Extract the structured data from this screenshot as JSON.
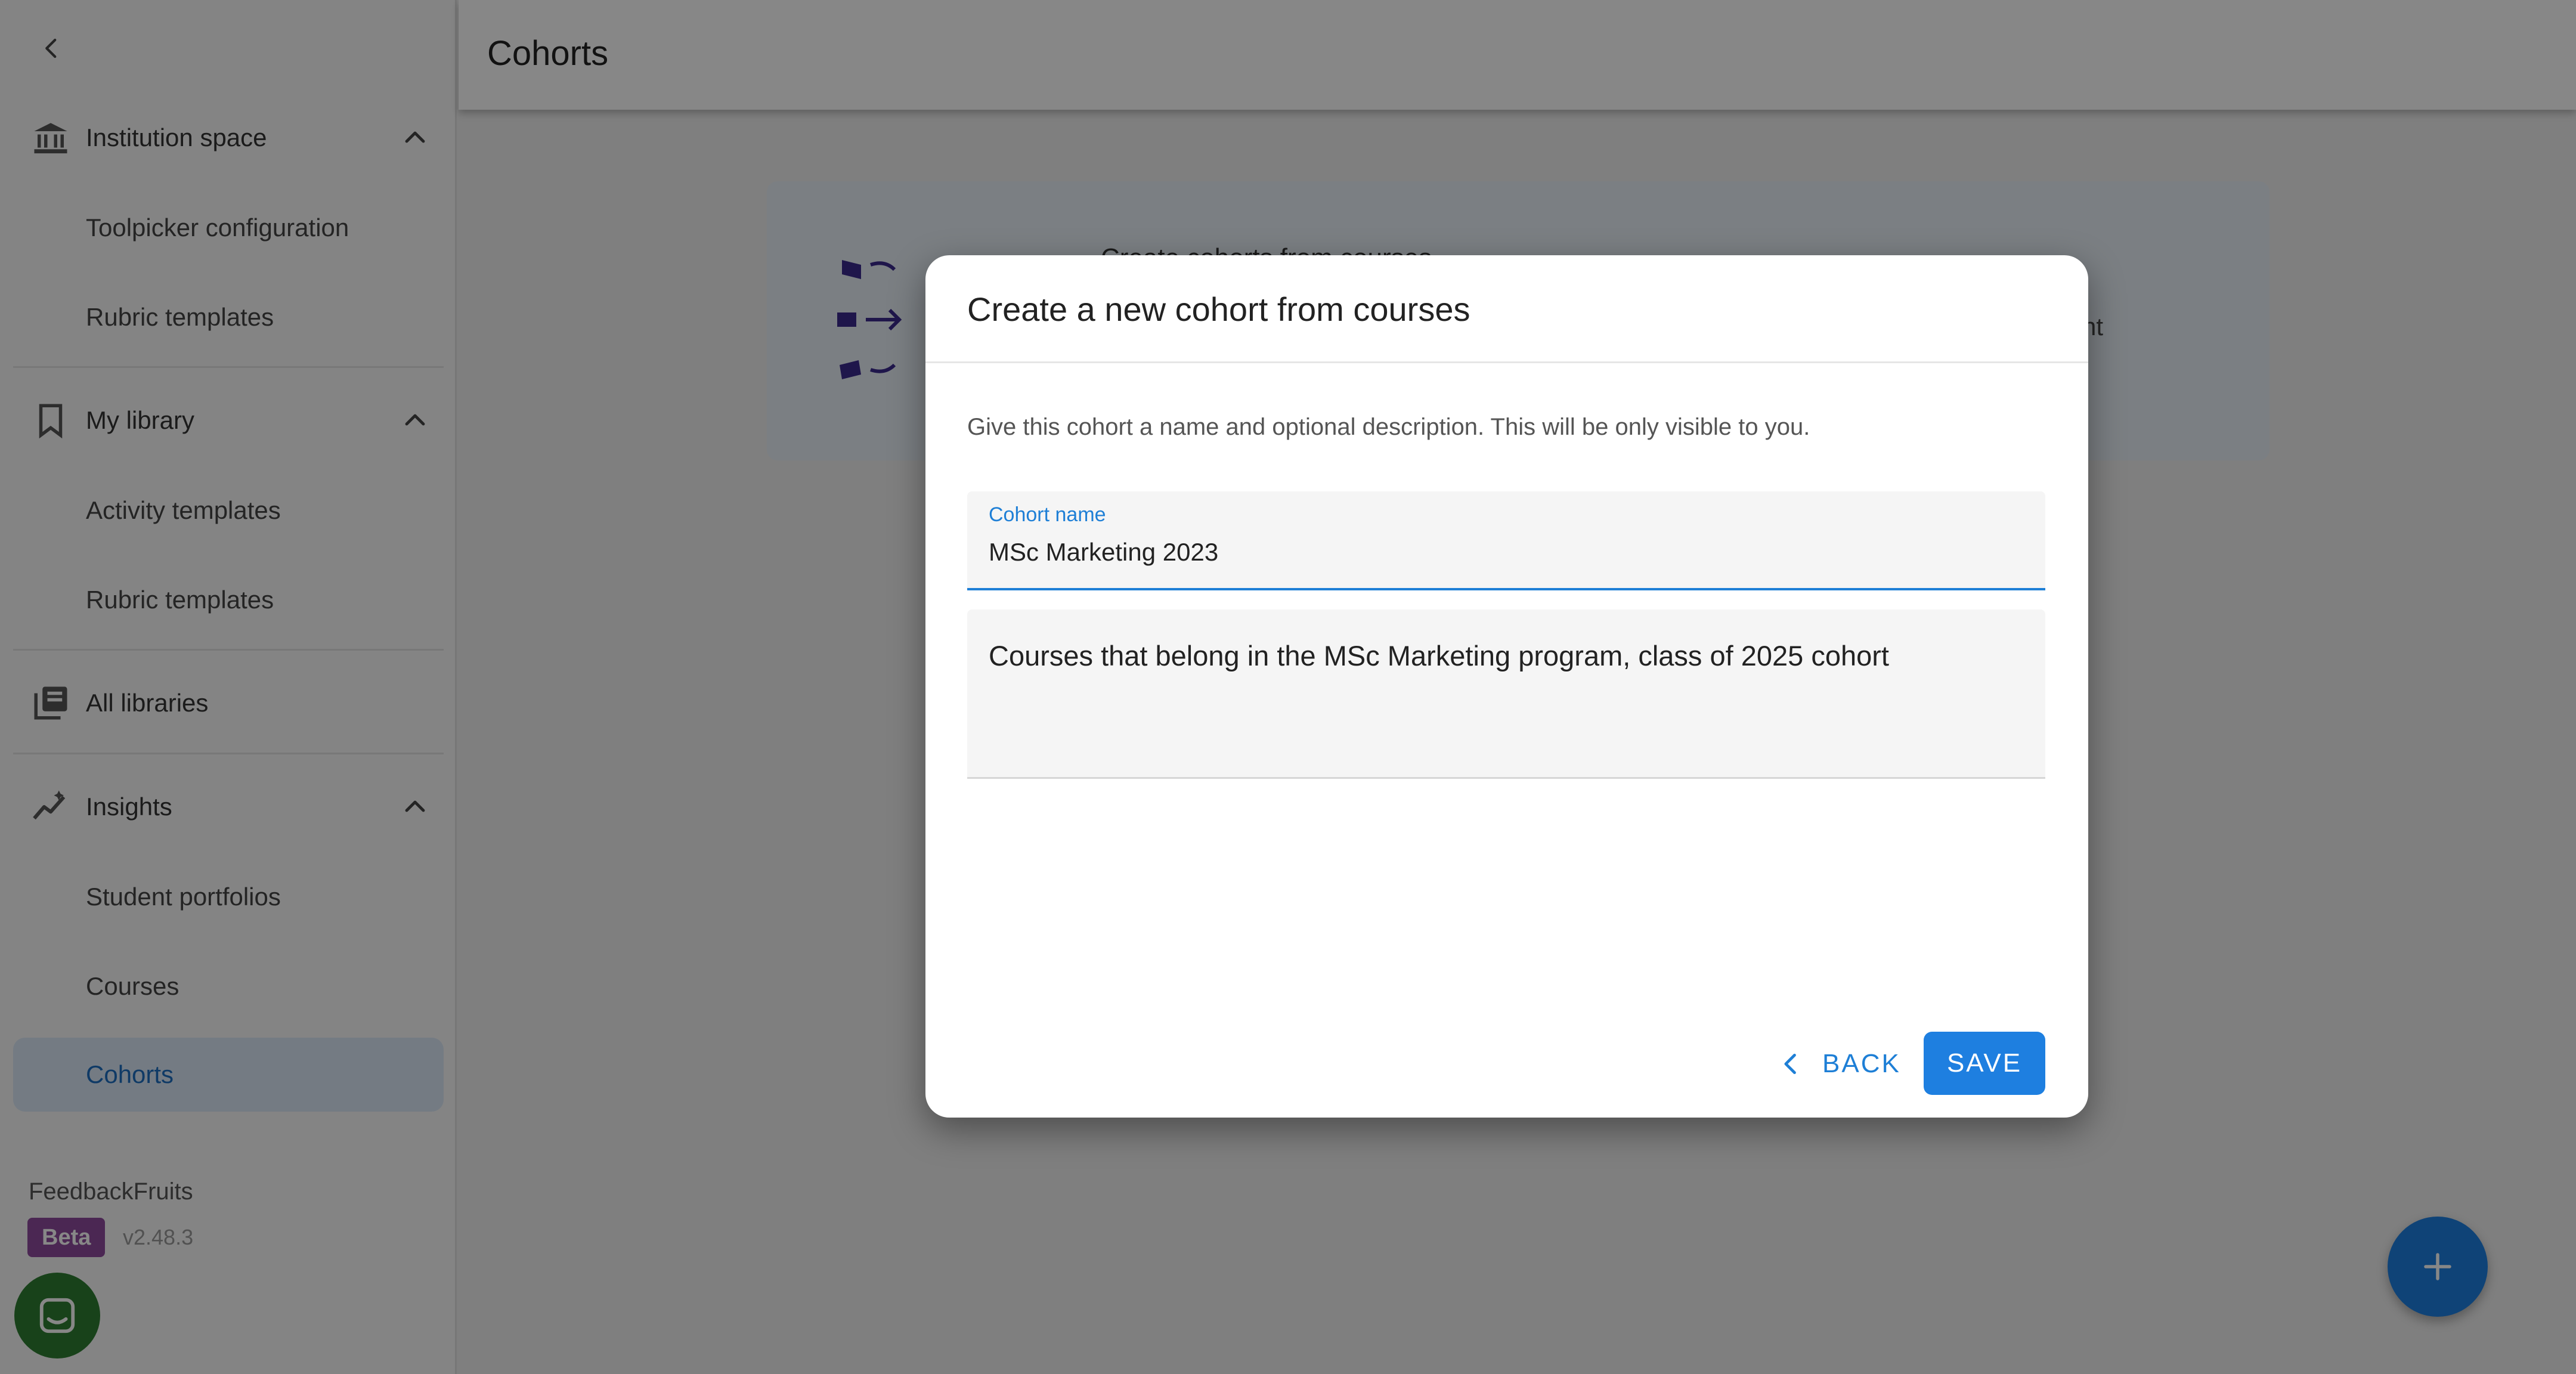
{
  "app": {
    "brand": "FeedbackFruits",
    "beta_label": "Beta",
    "version": "v2.48.3"
  },
  "header": {
    "title": "Cohorts"
  },
  "sidebar": {
    "sections": [
      {
        "label": "Institution space",
        "icon": "bank-icon",
        "items": [
          "Toolpicker configuration",
          "Rubric templates"
        ]
      },
      {
        "label": "My library",
        "icon": "bookmark-icon",
        "items": [
          "Activity templates",
          "Rubric templates"
        ]
      },
      {
        "label": "All libraries",
        "icon": "libraries-icon",
        "items": []
      },
      {
        "label": "Insights",
        "icon": "insights-icon",
        "items": [
          "Student portfolios",
          "Courses",
          "Cohorts"
        ]
      }
    ],
    "active_item": "Cohorts"
  },
  "banner": {
    "text_partial_1": "Create cohorts from courses",
    "text_partial_2": "evement"
  },
  "modal": {
    "title": "Create a new cohort from courses",
    "description": "Give this cohort a name and optional description. This will be only visible to you.",
    "name_label": "Cohort name",
    "name_value": "MSc Marketing 2023",
    "description_value": "Courses that belong in the MSc Marketing program, class of 2025 cohort",
    "back_label": "BACK",
    "save_label": "SAVE"
  },
  "colors": {
    "accent": "#1e7fe0",
    "active_bg": "#dbe9f8",
    "beta": "#8e4a9e",
    "chat": "#2e7d32"
  }
}
